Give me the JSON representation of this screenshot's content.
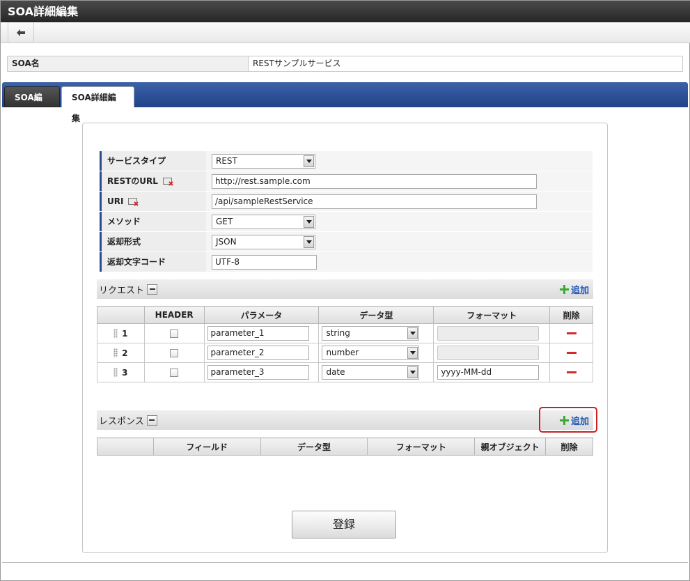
{
  "window": {
    "title": "SOA詳細編集"
  },
  "soa_name": {
    "label": "SOA名",
    "value": "RESTサンプルサービス"
  },
  "tabs": [
    {
      "label": "SOA編集"
    },
    {
      "label": "SOA詳細編集"
    }
  ],
  "form": {
    "service_type": {
      "label": "サービスタイプ",
      "value": "REST"
    },
    "rest_url": {
      "label": "RESTのURL",
      "value": "http://rest.sample.com"
    },
    "uri": {
      "label": "URI",
      "value": "/api/sampleRestService"
    },
    "method": {
      "label": "メソッド",
      "value": "GET"
    },
    "return_format": {
      "label": "返却形式",
      "value": "JSON"
    },
    "return_charset": {
      "label": "返却文字コード",
      "value": "UTF-8"
    }
  },
  "request": {
    "title": "リクエスト",
    "add_label": "追加",
    "columns": [
      "",
      "HEADER",
      "パラメータ",
      "データ型",
      "フォーマット",
      "削除"
    ],
    "rows": [
      {
        "num": "1",
        "param": "parameter_1",
        "type": "string",
        "format": ""
      },
      {
        "num": "2",
        "param": "parameter_2",
        "type": "number",
        "format": ""
      },
      {
        "num": "3",
        "param": "parameter_3",
        "type": "date",
        "format": "yyyy-MM-dd"
      }
    ]
  },
  "response": {
    "title": "レスポンス",
    "add_label": "追加",
    "columns": [
      "",
      "フィールド",
      "データ型",
      "フォーマット",
      "親オブジェクト",
      "削除"
    ]
  },
  "register_label": "登録",
  "colors": {
    "title_bar": "#262626",
    "tab_bar": "#20438a",
    "link": "#1f56b4",
    "add_icon": "#3aaa35",
    "delete_icon": "#d02a2a",
    "highlight": "#cc1f1f"
  }
}
